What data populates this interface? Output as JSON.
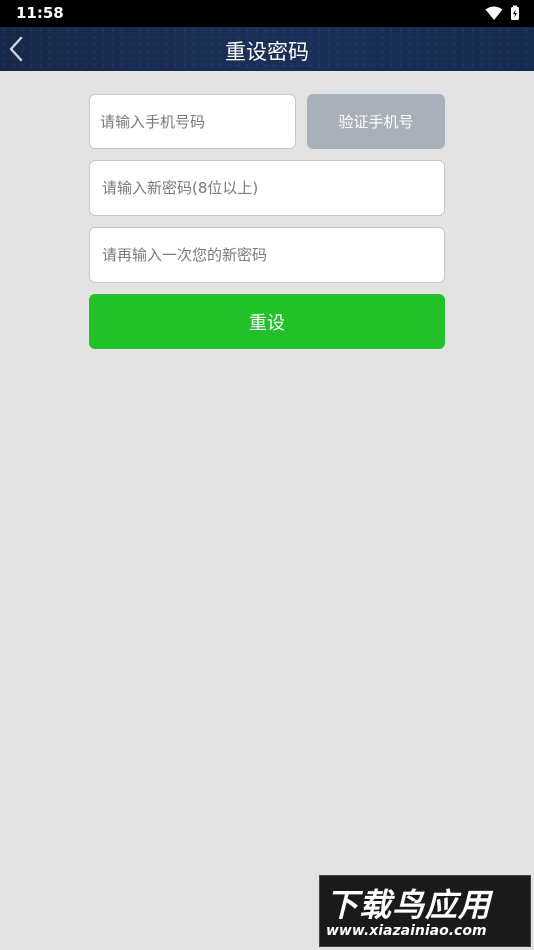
{
  "status_bar": {
    "time": "11:58"
  },
  "header": {
    "title": "重设密码"
  },
  "form": {
    "phone_placeholder": "请输入手机号码",
    "verify_label": "验证手机号",
    "new_password_placeholder": "请输入新密码(8位以上)",
    "confirm_password_placeholder": "请再输入一次您的新密码",
    "reset_label": "重设"
  },
  "watermark": {
    "brand": "下载鸟应用",
    "url": "www.xiazainiao.com"
  },
  "colors": {
    "header_bg": "#1b2f57",
    "reset_button": "#22c12a",
    "verify_button": "#a9b0ba",
    "page_bg": "#e3e3e3"
  }
}
